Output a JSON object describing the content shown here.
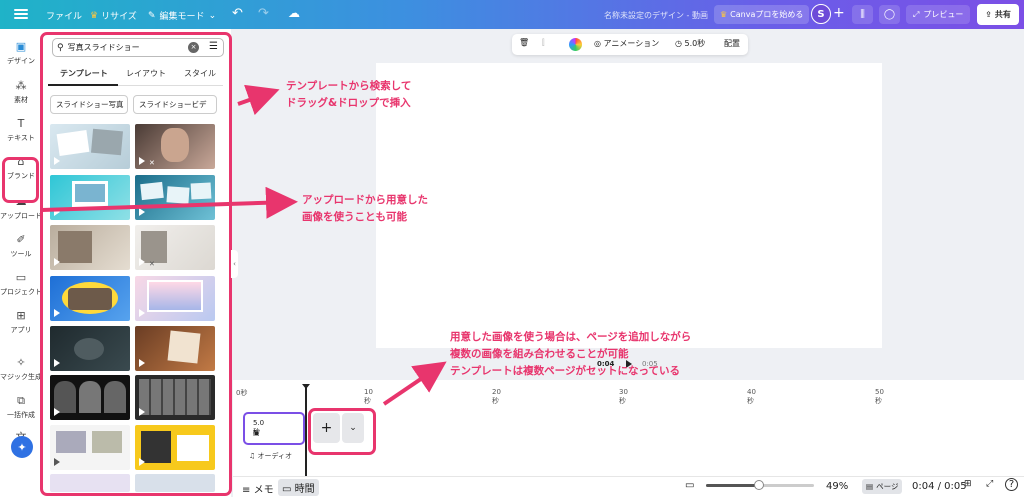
{
  "topbar": {
    "file": "ファイル",
    "resize": "リサイズ",
    "edit_mode": "編集モード",
    "doc_title": "名称未設定のデザイン - 動画",
    "canva_pro": "Canvaプロを始める",
    "avatar": "S",
    "preview": "プレビュー",
    "share": "共有"
  },
  "rail": {
    "items": [
      {
        "label": "デザイン",
        "icon": "design-icon"
      },
      {
        "label": "素材",
        "icon": "elements-icon"
      },
      {
        "label": "テキスト",
        "icon": "text-icon"
      },
      {
        "label": "ブランド",
        "icon": "brand-icon"
      },
      {
        "label": "アップロード",
        "icon": "upload-icon"
      },
      {
        "label": "ツール",
        "icon": "draw-icon"
      },
      {
        "label": "プロジェクト",
        "icon": "folder-icon"
      },
      {
        "label": "アプリ",
        "icon": "apps-icon"
      },
      {
        "label": "マジック生成",
        "icon": "magic-media-icon"
      },
      {
        "label": "一括作成",
        "icon": "bulk-create-icon"
      },
      {
        "label": "",
        "icon": "translate-icon"
      }
    ]
  },
  "panel": {
    "search_value": "写真スライドショー",
    "tabs": [
      "テンプレート",
      "レイアウト",
      "スタイル"
    ],
    "chips": [
      "スライドショー写真",
      "スライドショービデ"
    ]
  },
  "canvas_toolbar": {
    "animation": "アニメーション",
    "duration": "5.0秒",
    "position": "配置"
  },
  "canvas_time": {
    "current": "0:04",
    "total": "0:05"
  },
  "timeline": {
    "ruler": [
      "0秒",
      "10秒",
      "20秒",
      "30秒",
      "40秒",
      "50秒"
    ],
    "clip_duration": "5.0秒",
    "audio_label": "オーディオ"
  },
  "bottombar": {
    "notes": "メモ",
    "timer": "時間",
    "zoom": "49%",
    "pages": "ページ",
    "time": "0:04 / 0:05",
    "help": "?"
  },
  "annotations": {
    "a1": [
      "テンプレートから検索して",
      "ドラッグ&ドロップで挿入"
    ],
    "a2": [
      "アップロードから用意した",
      "画像を使うことも可能"
    ],
    "a3": [
      "用意した画像を使う場合は、ページを追加しながら",
      "複数の画像を組み合わせることが可能",
      "テンプレートは複数ページがセットになっている"
    ]
  },
  "colors": {
    "annotation": "#e8356d",
    "accent": "#7b4fe6",
    "topbar_start": "#1fb3c8",
    "topbar_end": "#7b4fe6"
  }
}
